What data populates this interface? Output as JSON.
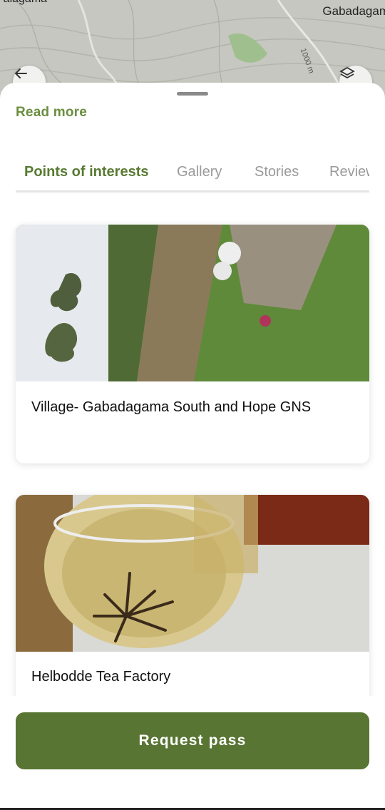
{
  "map": {
    "town_label": "Gabadagam",
    "corner_label": "Palagama",
    "elevation_label": "1000 m",
    "back_icon": "back-arrow-icon",
    "layers_icon": "layers-icon"
  },
  "sheet": {
    "read_more": "Read more",
    "tabs": [
      {
        "label": "Points of interests",
        "active": true
      },
      {
        "label": "Gallery",
        "active": false
      },
      {
        "label": "Stories",
        "active": false
      },
      {
        "label": "Reviews",
        "active": false
      }
    ],
    "cards": [
      {
        "title": "Village- Gabadagama South and Hope GNS",
        "image": "village-photo"
      },
      {
        "title": "Helbodde Tea Factory",
        "image": "tea-glass-photo"
      }
    ],
    "request_button": "Request pass"
  },
  "colors": {
    "accent": "#587a32",
    "link": "#6b8e3f",
    "button": "#587533"
  }
}
